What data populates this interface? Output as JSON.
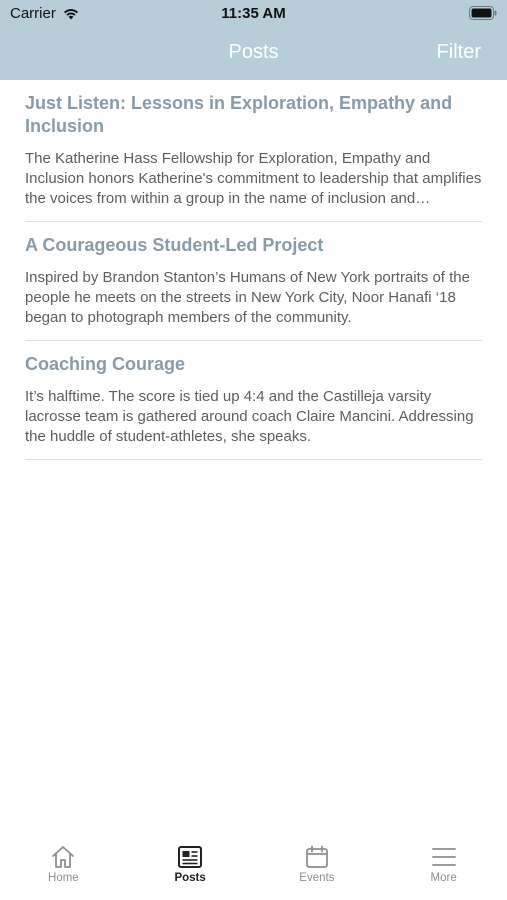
{
  "status_bar": {
    "carrier": "Carrier",
    "time": "11:35 AM"
  },
  "nav": {
    "title": "Posts",
    "filter_label": "Filter"
  },
  "colors": {
    "nav_background": "#b7ced9",
    "post_title": "#8a9ba6",
    "tab_active": "#222222",
    "tab_inactive": "#8e8e93"
  },
  "posts": [
    {
      "title": "Just Listen: Lessons in Exploration, Empathy and Inclusion",
      "excerpt": "The Katherine Hass Fellowship for Exploration, Empathy and Inclusion honors Katherine's commitment to leadership that amplifies the voices from within a group in the name of inclusion and understanding."
    },
    {
      "title": "A Courageous Student-Led Project",
      "excerpt": "Inspired by Brandon Stanton’s Humans of New York portraits of the people he meets on the streets in New York City, Noor Hanafi ‘18 began to photograph members of the community."
    },
    {
      "title": "Coaching Courage",
      "excerpt": "It’s halftime. The score is tied up 4:4 and the Castilleja varsity lacrosse team is gathered around coach Claire Mancini. Addressing the huddle of student-athletes, she speaks."
    }
  ],
  "tabs": [
    {
      "label": "Home",
      "icon": "home-icon"
    },
    {
      "label": "Posts",
      "icon": "newspaper-icon",
      "active": true
    },
    {
      "label": "Events",
      "icon": "calendar-icon"
    },
    {
      "label": "More",
      "icon": "menu-icon"
    }
  ]
}
